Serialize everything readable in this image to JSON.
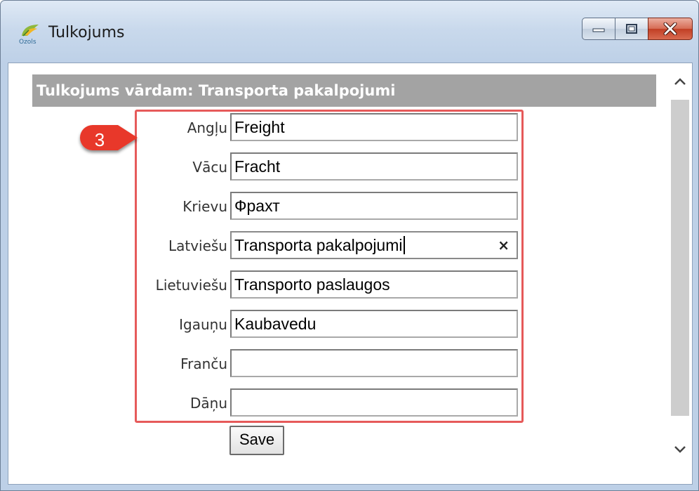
{
  "window": {
    "title": "Tulkojums",
    "icon": "ozols-app-icon",
    "icon_text": "Ozols"
  },
  "form": {
    "header": "Tulkojums vārdam: Transporta pakalpojumi",
    "callout_number": "3",
    "fields": [
      {
        "label": "Angļu",
        "value": "Freight"
      },
      {
        "label": "Vācu",
        "value": "Fracht"
      },
      {
        "label": "Krievu",
        "value": "Фрахт"
      },
      {
        "label": "Latviešu",
        "value": "Transporta pakalpojumi"
      },
      {
        "label": "Lietuviešu",
        "value": "Transporto paslaugos"
      },
      {
        "label": "Igauņu",
        "value": "Kaubavedu"
      },
      {
        "label": "Franču",
        "value": ""
      },
      {
        "label": "Dāņu",
        "value": ""
      }
    ],
    "clear_glyph": "×",
    "save_label": "Save"
  },
  "colors": {
    "highlight": "#e65a5a",
    "header_bg": "#a3a3a3",
    "callout": "#e8372c"
  }
}
